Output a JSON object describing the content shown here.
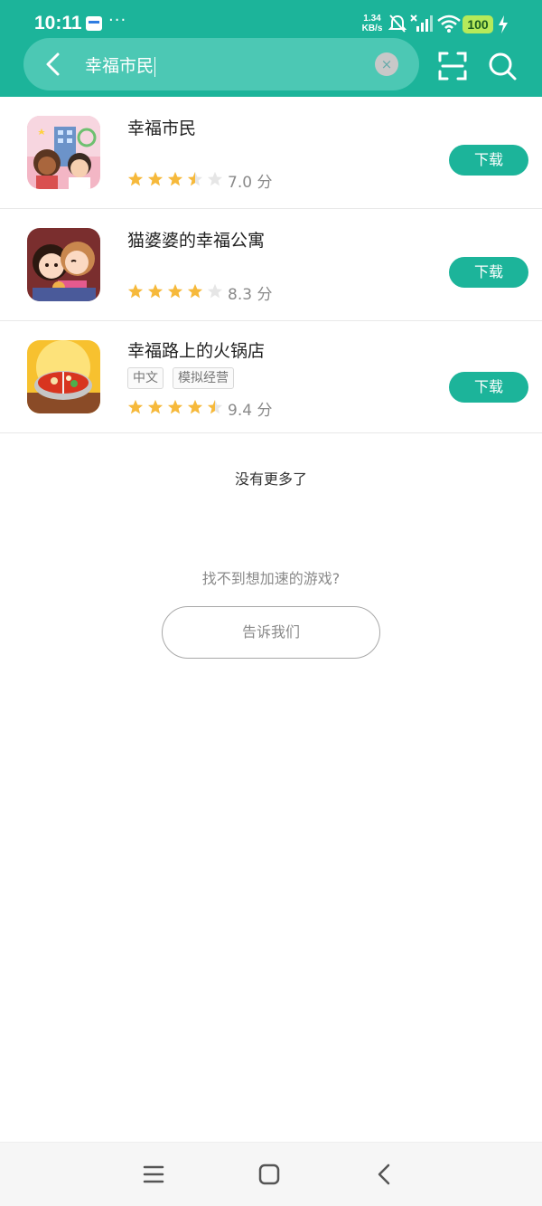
{
  "status_bar": {
    "time": "10:11",
    "more": "···",
    "net_speed_value": "1.34",
    "net_speed_unit": "KB/s",
    "battery": "100"
  },
  "search": {
    "query": "幸福市民",
    "clear_symbol": "×"
  },
  "results": [
    {
      "title": "幸福市民",
      "tags": [],
      "rating_stars": 3.5,
      "score": "7.0 分",
      "download_label": "下载",
      "icon": "happy-citizens-game-icon"
    },
    {
      "title": "猫婆婆的幸福公寓",
      "tags": [],
      "rating_stars": 4,
      "score": "8.3 分",
      "download_label": "下载",
      "icon": "granny-cat-apartment-game-icon"
    },
    {
      "title": "幸福路上的火锅店",
      "tags": [
        "中文",
        "模拟经营"
      ],
      "rating_stars": 4.5,
      "score": "9.4 分",
      "download_label": "下载",
      "icon": "hotpot-restaurant-game-icon"
    }
  ],
  "footer": {
    "no_more": "没有更多了",
    "cant_find": "找不到想加速的游戏?",
    "tell_us": "告诉我们"
  },
  "colors": {
    "accent": "#1cb49a",
    "star_filled": "#f6b93b",
    "star_empty": "#e6e6e6"
  }
}
